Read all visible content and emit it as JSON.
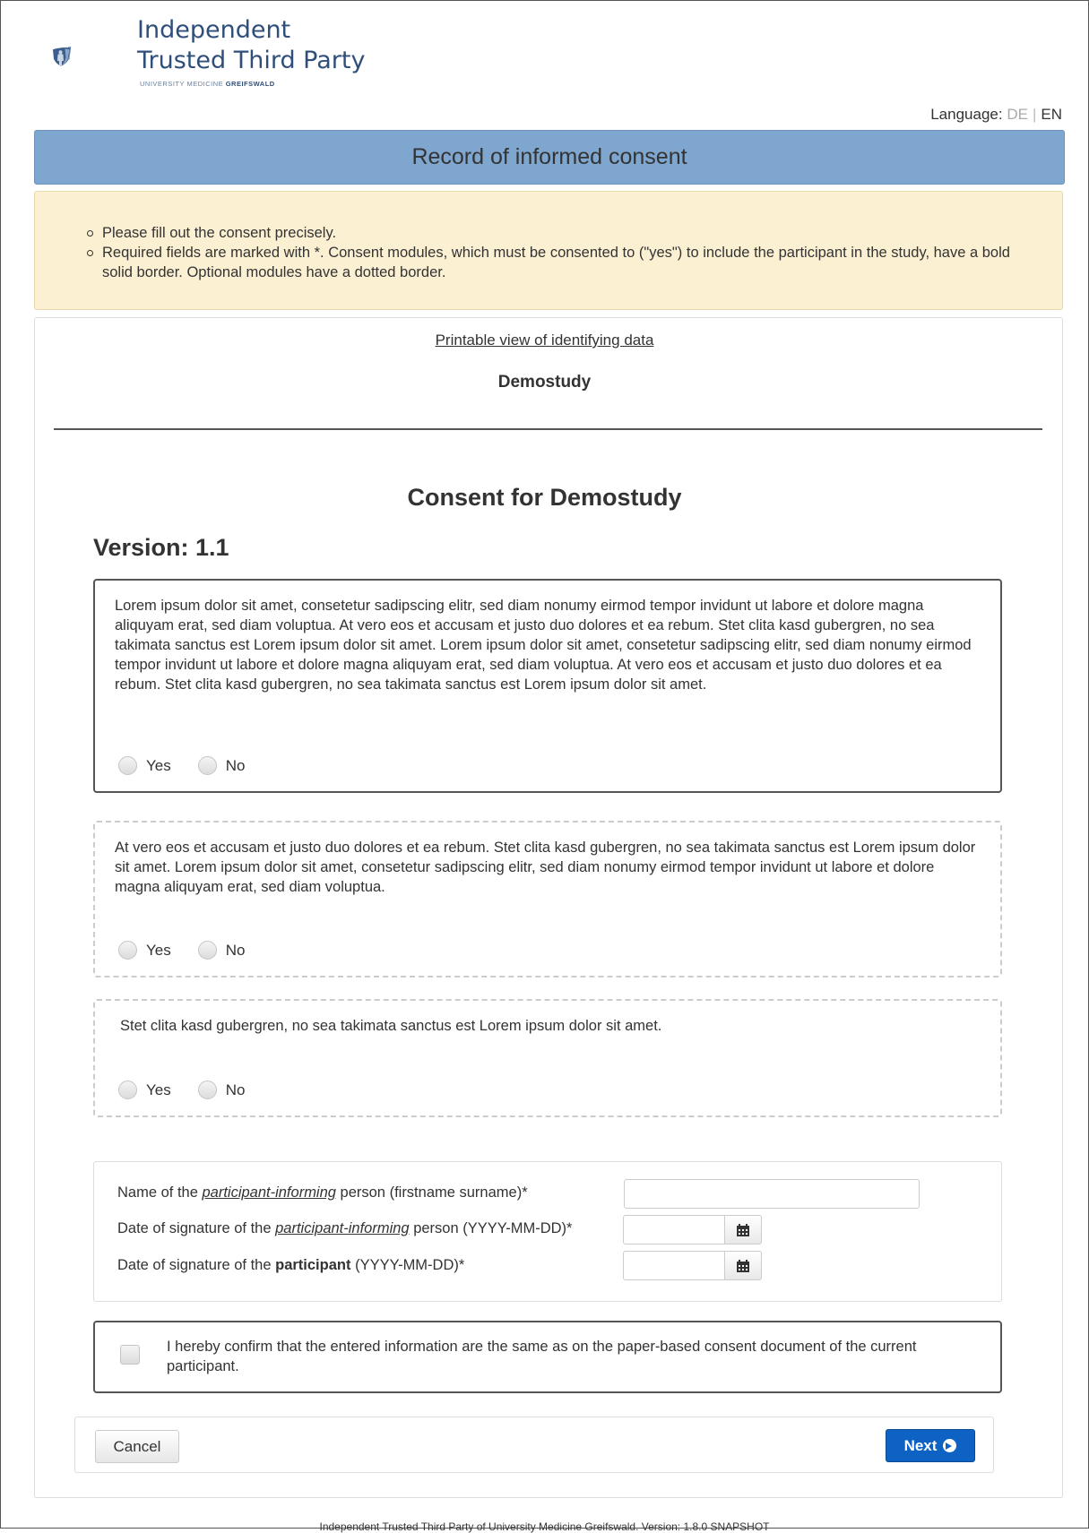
{
  "logo": {
    "line1": "Independent",
    "line2": "Trusted Third Party",
    "sub_prefix": "UNIVERSITY MEDICINE ",
    "sub_bold": "GREIFSWALD"
  },
  "language": {
    "label": "Language:",
    "options": [
      "DE",
      "EN"
    ],
    "selected": "EN"
  },
  "page_title": "Record of informed consent",
  "info": {
    "items": [
      "Please fill out the consent precisely.",
      "Required fields are marked with *. Consent modules, which must be consented to (\"yes\") to include the participant in the study, have a bold solid border. Optional modules have a dotted border."
    ]
  },
  "print_link": "Printable view of identifying data",
  "study_name": "Demostudy",
  "consent_title": "Consent for Demostudy",
  "version": "Version: 1.1",
  "modules": [
    {
      "required": true,
      "text": "Lorem ipsum dolor sit amet, consetetur sadipscing elitr, sed diam nonumy eirmod tempor invidunt ut labore et dolore magna aliquyam erat, sed diam voluptua. At vero eos et accusam et justo duo dolores et ea rebum. Stet clita kasd gubergren, no sea takimata sanctus est Lorem ipsum dolor sit amet. Lorem ipsum dolor sit amet, consetetur sadipscing elitr, sed diam nonumy eirmod tempor invidunt ut labore et dolore magna aliquyam erat, sed diam voluptua. At vero eos et accusam et justo duo dolores et ea rebum. Stet clita kasd gubergren, no sea takimata sanctus est Lorem ipsum dolor sit amet.",
      "yes_label": "Yes",
      "no_label": "No"
    },
    {
      "required": false,
      "text": "At vero eos et accusam et justo duo dolores et ea rebum. Stet clita kasd gubergren, no sea takimata sanctus est Lorem ipsum dolor sit amet. Lorem ipsum dolor sit amet, consetetur sadipscing elitr, sed diam nonumy eirmod tempor invidunt ut labore et dolore magna aliquyam erat, sed diam voluptua.",
      "yes_label": "Yes",
      "no_label": "No"
    },
    {
      "required": false,
      "text": "Stet clita kasd gubergren, no sea takimata sanctus est Lorem ipsum dolor sit amet.",
      "yes_label": "Yes",
      "no_label": "No"
    }
  ],
  "signature": {
    "informer_name": {
      "prefix": "Name of the ",
      "emph": "participant-informing",
      "suffix": " person (firstname surname)*",
      "value": ""
    },
    "informer_date": {
      "prefix": "Date of signature of the ",
      "emph": "participant-informing",
      "suffix": " person (YYYY-MM-DD)*",
      "value": ""
    },
    "participant_date": {
      "prefix": "Date of signature of the ",
      "bold": "participant",
      "suffix": " (YYYY-MM-DD)*",
      "value": ""
    },
    "calendar_icon": "calendar-icon"
  },
  "confirm_text": "I hereby confirm that the entered information are the same as on the paper-based consent document of the current participant.",
  "buttons": {
    "cancel": "Cancel",
    "next": "Next"
  },
  "footer": "Independent Trusted Third Party of University Medicine Greifswald. Version: 1.8.0 SNAPSHOT",
  "colors": {
    "title_bar": "#7ea6cf",
    "info_bg": "#fcf0d3",
    "primary_button": "#0d62c4",
    "logo_text": "#2f4f7a"
  }
}
